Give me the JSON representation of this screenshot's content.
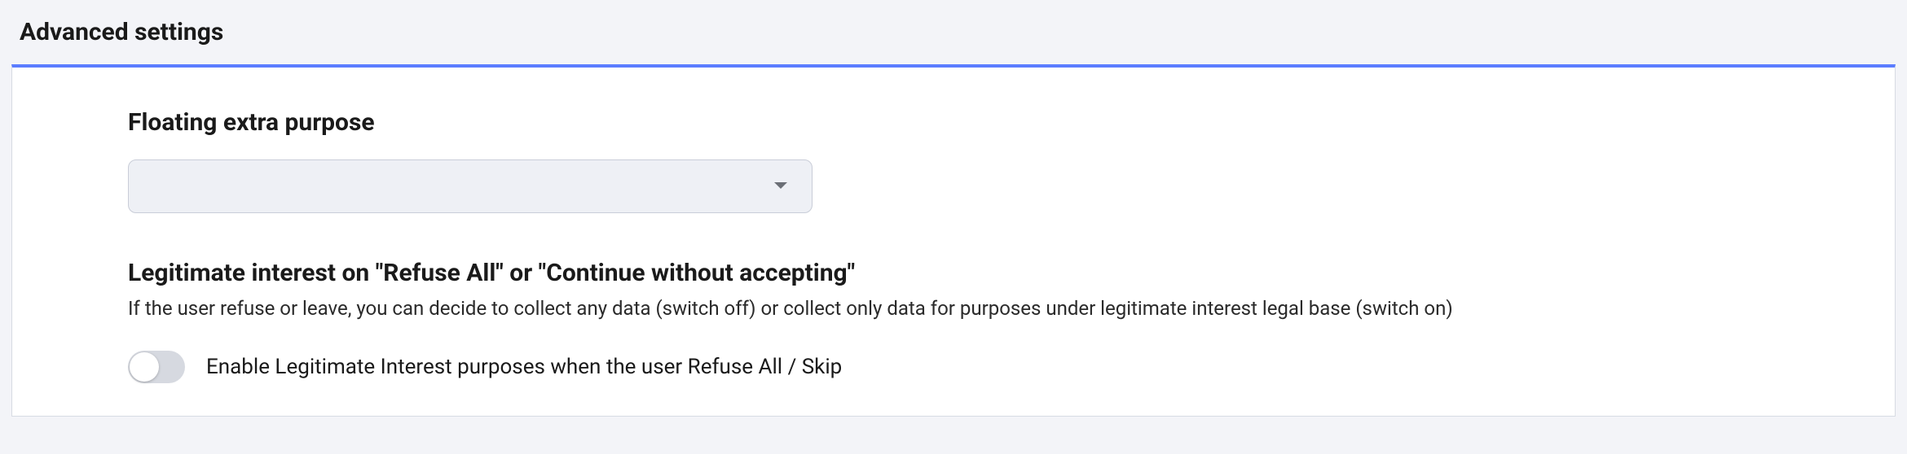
{
  "panel": {
    "title": "Advanced settings"
  },
  "floating_purpose": {
    "heading": "Floating extra purpose",
    "selected": ""
  },
  "legitimate_interest": {
    "heading": "Legitimate interest on \"Refuse All\" or \"Continue without accepting\"",
    "description": "If the user refuse or leave, you can decide to collect any data (switch off) or collect only data for purposes under legitimate interest legal base (switch on)",
    "toggle": {
      "enabled": false,
      "label": "Enable Legitimate Interest purposes when the user Refuse All / Skip"
    }
  },
  "colors": {
    "accent": "#5b7cff",
    "panel_bg": "#ffffff",
    "page_bg": "#f3f4f8",
    "border": "#d7dbe3",
    "input_bg": "#eef0f5",
    "toggle_track": "#d6d9e0"
  }
}
